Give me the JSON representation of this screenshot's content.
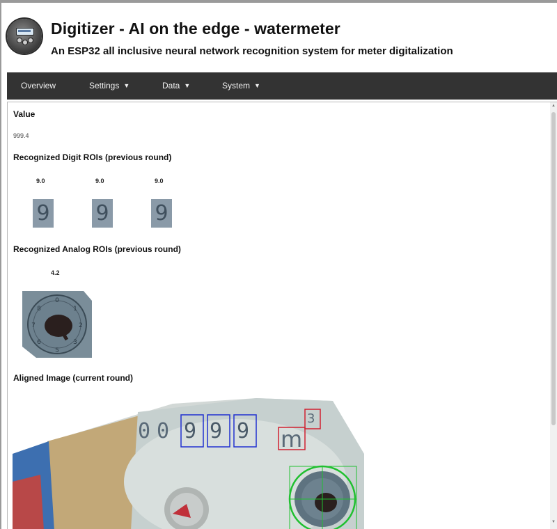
{
  "header": {
    "title": "Digitizer - AI on the edge - watermeter",
    "subtitle": "An ESP32 all inclusive neural network recognition system for meter digitalization"
  },
  "nav": {
    "items": [
      {
        "label": "Overview",
        "dropdown": false
      },
      {
        "label": "Settings",
        "dropdown": true
      },
      {
        "label": "Data",
        "dropdown": true
      },
      {
        "label": "System",
        "dropdown": true
      }
    ]
  },
  "content": {
    "value_heading": "Value",
    "value_text": "999.4",
    "digit_heading": "Recognized Digit ROIs (previous round)",
    "digits": [
      {
        "label": "9.0",
        "glyph": "9"
      },
      {
        "label": "9.0",
        "glyph": "9"
      },
      {
        "label": "9.0",
        "glyph": "9"
      }
    ],
    "analog_heading": "Recognized Analog ROIs (previous round)",
    "analogs": [
      {
        "label": "4.2"
      }
    ],
    "aligned_heading": "Aligned Image (current round)",
    "aligned_image": {
      "meter_digits": [
        "0",
        "0",
        "9",
        "9",
        "9"
      ],
      "unit": "m",
      "unit_superscript": "3",
      "colors": {
        "digit_roi": "#2030d0",
        "unit_box": "#d02030",
        "analog_roi": "#20c030"
      }
    }
  },
  "colors": {
    "nav_background": "#333333",
    "nav_text": "#f2f2f2"
  }
}
